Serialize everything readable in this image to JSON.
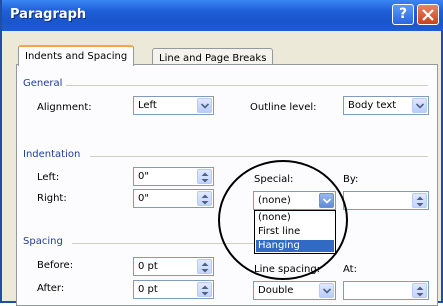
{
  "window": {
    "title": "Paragraph"
  },
  "tabs": [
    {
      "label": "Indents and Spacing",
      "active": true
    },
    {
      "label": "Line and Page Breaks",
      "active": false
    }
  ],
  "general": {
    "heading": "General",
    "alignment_label": "Alignment:",
    "alignment_value": "Left",
    "outline_label": "Outline level:",
    "outline_value": "Body text"
  },
  "indentation": {
    "heading": "Indentation",
    "left_label": "Left:",
    "left_value": "0\"",
    "right_label": "Right:",
    "right_value": "0\"",
    "special_label": "Special:",
    "special_value": "(none)",
    "by_label": "By:",
    "special_options": [
      "(none)",
      "First line",
      "Hanging"
    ],
    "highlighted_option": "Hanging"
  },
  "spacing": {
    "heading": "Spacing",
    "before_label": "Before:",
    "before_value": "0 pt",
    "after_label": "After:",
    "after_value": "0 pt",
    "line_spacing_label": "Line spacing:",
    "line_spacing_value": "Double",
    "at_label": "At:"
  },
  "colors": {
    "title_bar": "#1f5fd8",
    "section_heading": "#1e3e9a",
    "selection": "#316ac5",
    "active_tab_accent": "#f5a73d"
  }
}
